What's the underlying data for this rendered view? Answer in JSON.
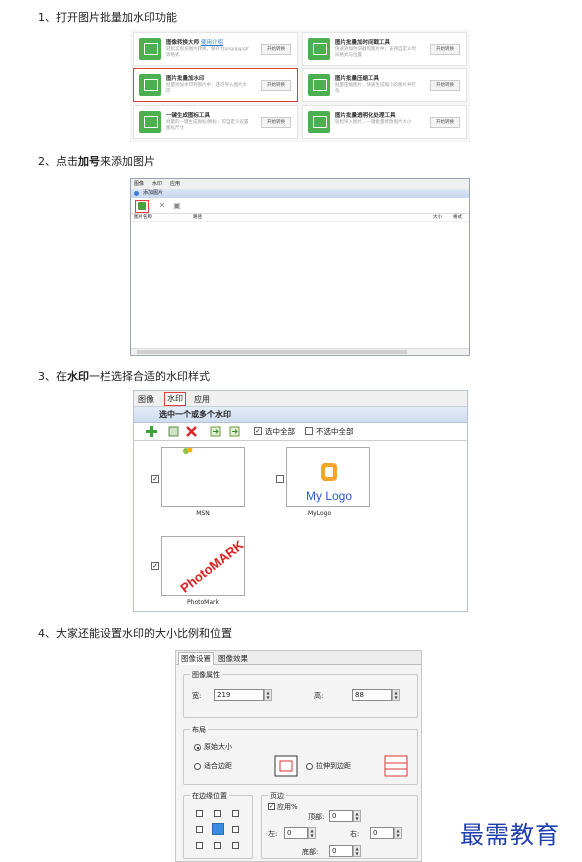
{
  "steps": [
    {
      "num": "1、",
      "text": "打开图片批量加水印功能"
    },
    {
      "num": "2、",
      "text_pre": "点击",
      "text_bold": "加号",
      "text_post": "来添加图片"
    },
    {
      "num": "3、",
      "text_pre": "在",
      "text_bold": "水印",
      "text_post": "一栏选择合适的水印样式"
    },
    {
      "num": "4、",
      "text": "大家还能设置水印的大小比例和位置"
    }
  ],
  "tools": [
    {
      "name": "图像转换大师",
      "link": "使用介绍",
      "desc": "轻松实现多图片转换，保存为png/jpg/gif等格式",
      "button": "开始转换"
    },
    {
      "name": "图片批量加时间戳工具",
      "desc": "快速添加时间戳到图片中，支持自定义时间格式与位置",
      "button": "开始转换"
    },
    {
      "name": "图片批量加水印",
      "desc": "批量添加水印到图片中，还可导入图片水印",
      "button": "开始转换"
    },
    {
      "name": "图片批量压缩工具",
      "desc": "批量压缩图片，快速生成缩小的图片并打包",
      "button": "开始转换"
    },
    {
      "name": "一键生成图标工具",
      "desc": "批量的一键生成图标/图标，可自定义设置图标尺寸",
      "button": "开始转换"
    },
    {
      "name": "图片批量透明化处理工具",
      "desc": "轻松导入图片，一键批量修改图片大小",
      "button": "开始转换"
    }
  ],
  "add_window": {
    "menu": [
      "图像",
      "水印",
      "应用"
    ],
    "title": "添加图片",
    "toolbar_icons": [
      "add-icon",
      "delete-icon",
      "copy-icon"
    ],
    "columns": [
      "图片名称",
      "路径",
      "大小",
      "格式"
    ]
  },
  "watermark": {
    "tabs": [
      "图像",
      "水印",
      "应用"
    ],
    "selected_tab": "水印",
    "header": "选中一个或多个水印",
    "select_all": "选中全部",
    "deselect_all": "不选中全部",
    "items": [
      {
        "caption": "MSN",
        "checked": true
      },
      {
        "caption": "MyLogo",
        "checked": false,
        "logo_text": "My Logo"
      },
      {
        "caption": "PhotoMark",
        "checked": true,
        "stamp_text": "PhotoMARK"
      }
    ]
  },
  "settings": {
    "tabs": [
      "图像设置",
      "图像效果"
    ],
    "props_title": "图像属性",
    "width_label": "宽:",
    "width_value": "219",
    "height_label": "高:",
    "height_value": "88",
    "layout_title": "布局",
    "layout_original": "原始大小",
    "layout_fit": "适合边距",
    "layout_stretch": "拉伸到边距",
    "position_title": "在边缘位置",
    "margin_title": "页边",
    "apply_percent": "应用%",
    "top_label": "顶部:",
    "top_value": "0",
    "left_label": "左:",
    "left_value": "0",
    "right_label": "右:",
    "right_value": "0",
    "bottom_label": "底部:",
    "bottom_value": "0"
  },
  "brand": "最需教育",
  "colors": {
    "highlight": "#e23c3c",
    "tool_green": "#4caf50",
    "brand_blue": "#1f3fae"
  }
}
